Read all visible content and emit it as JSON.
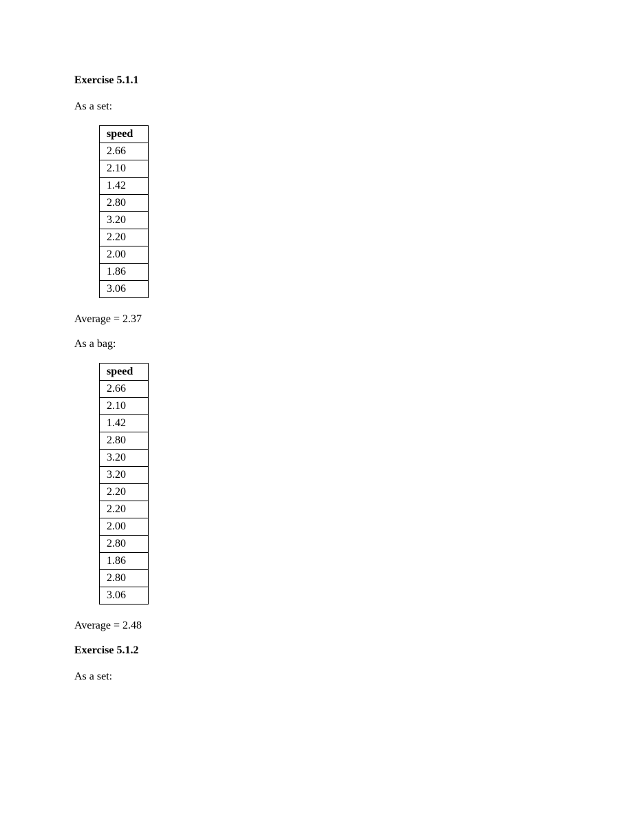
{
  "exercise1": {
    "title": "Exercise 5.1.1",
    "set": {
      "label": "As a set:",
      "header": "speed",
      "values": [
        "2.66",
        "2.10",
        "1.42",
        "2.80",
        "3.20",
        "2.20",
        "2.00",
        "1.86",
        "3.06"
      ],
      "average": "Average = 2.37"
    },
    "bag": {
      "label": "As a bag:",
      "header": "speed",
      "values": [
        "2.66",
        "2.10",
        "1.42",
        "2.80",
        "3.20",
        "3.20",
        "2.20",
        "2.20",
        "2.00",
        "2.80",
        "1.86",
        "2.80",
        "3.06"
      ],
      "average": "Average = 2.48"
    }
  },
  "exercise2": {
    "title": "Exercise 5.1.2",
    "set": {
      "label": "As a set:"
    }
  }
}
